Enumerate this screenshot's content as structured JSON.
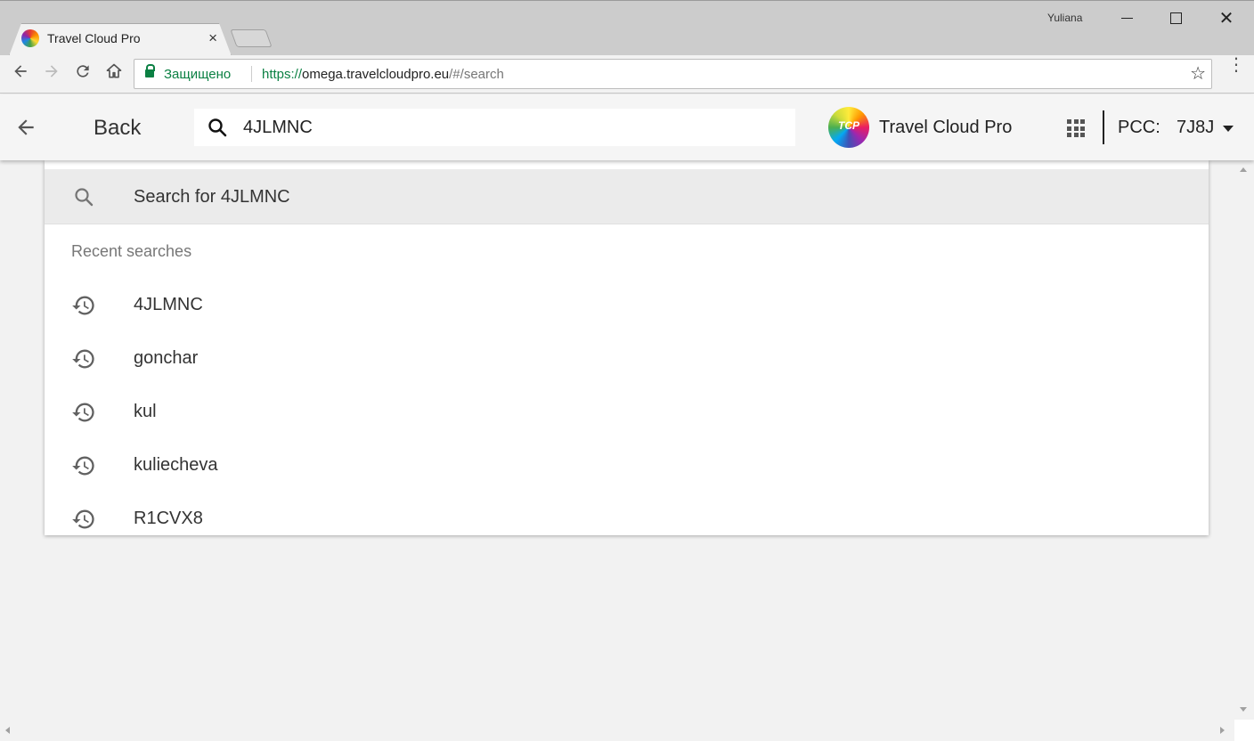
{
  "browser": {
    "tab_title": "Travel Cloud Pro",
    "tab_close": "×",
    "user_name": "Yuliana",
    "secure_label": "Защищено",
    "url_scheme": "https://",
    "url_host": "omega.travelcloudpro.eu",
    "url_path": "/#/search",
    "icons": {
      "back": "back-arrow-icon",
      "forward": "forward-arrow-icon",
      "reload": "reload-icon",
      "home": "home-icon",
      "star": "star-icon",
      "menu": "more-vert-icon"
    }
  },
  "header": {
    "back_label": "Back",
    "search_value": "4JLMNC",
    "logo_text": "TCP",
    "brand_name": "Travel Cloud Pro",
    "pcc_label": "PCC:",
    "pcc_value": "7J8J"
  },
  "dropdown": {
    "search_for_label": "Search for 4JLMNC",
    "recent_header": "Recent searches",
    "recent": [
      {
        "label": "4JLMNC"
      },
      {
        "label": "gonchar"
      },
      {
        "label": "kul"
      },
      {
        "label": "kuliecheva"
      },
      {
        "label": "R1CVX8"
      }
    ]
  },
  "colors": {
    "secure_green": "#0b8043",
    "header_bg": "#f5f5f5",
    "page_bg": "#f2f2f2"
  }
}
